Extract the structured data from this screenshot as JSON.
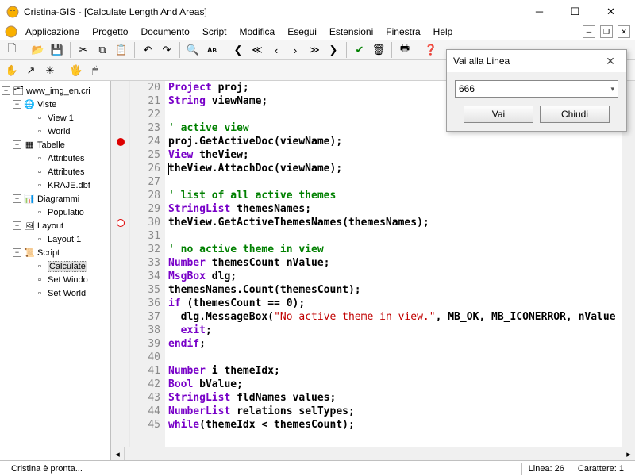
{
  "window": {
    "title": "Cristina-GIS - [Calculate Length And Areas]"
  },
  "menus": [
    "Applicazione",
    "Progetto",
    "Documento",
    "Script",
    "Modifica",
    "Esegui",
    "Estensioni",
    "Finestra",
    "Help"
  ],
  "tree": {
    "root": "www_img_en.cri",
    "groups": [
      {
        "label": "Viste",
        "icon": "globe",
        "items": [
          "View 1",
          "World"
        ]
      },
      {
        "label": "Tabelle",
        "icon": "table",
        "items": [
          "Attributes",
          "Attributes",
          "KRAJE.dbf"
        ]
      },
      {
        "label": "Diagrammi",
        "icon": "chart",
        "items": [
          "Populatio"
        ]
      },
      {
        "label": "Layout",
        "icon": "layout",
        "items": [
          "Layout 1"
        ]
      },
      {
        "label": "Script",
        "icon": "script",
        "items": [
          "Calculate",
          "Set Windo",
          "Set World"
        ],
        "selected": 0
      }
    ]
  },
  "editor": {
    "first_line": 20,
    "cursor_line": 26,
    "breakpoints": {
      "24": "solid",
      "30": "hollow"
    },
    "lines": [
      {
        "n": 20,
        "t": [
          [
            "kw",
            "Project"
          ],
          [
            "txt",
            " proj;"
          ]
        ]
      },
      {
        "n": 21,
        "t": [
          [
            "kw",
            "String"
          ],
          [
            "txt",
            " viewName;"
          ]
        ]
      },
      {
        "n": 22,
        "t": []
      },
      {
        "n": 23,
        "t": [
          [
            "cm",
            "' active view"
          ]
        ]
      },
      {
        "n": 24,
        "t": [
          [
            "txt",
            "proj.GetActiveDoc(viewName);"
          ]
        ]
      },
      {
        "n": 25,
        "t": [
          [
            "kw",
            "View"
          ],
          [
            "txt",
            " theView;"
          ]
        ]
      },
      {
        "n": 26,
        "t": [
          [
            "txt",
            "theView.AttachDoc(viewName);"
          ]
        ]
      },
      {
        "n": 27,
        "t": []
      },
      {
        "n": 28,
        "t": [
          [
            "cm",
            "' list of all active themes"
          ]
        ]
      },
      {
        "n": 29,
        "t": [
          [
            "kw",
            "StringList"
          ],
          [
            "txt",
            " themesNames;"
          ]
        ]
      },
      {
        "n": 30,
        "t": [
          [
            "txt",
            "theView.GetActiveThemesNames(themesNames);"
          ]
        ]
      },
      {
        "n": 31,
        "t": []
      },
      {
        "n": 32,
        "t": [
          [
            "cm",
            "' no active theme in view"
          ]
        ]
      },
      {
        "n": 33,
        "t": [
          [
            "kw",
            "Number"
          ],
          [
            "txt",
            " themesCount nValue;"
          ]
        ]
      },
      {
        "n": 34,
        "t": [
          [
            "kw",
            "MsgBox"
          ],
          [
            "txt",
            " dlg;"
          ]
        ]
      },
      {
        "n": 35,
        "t": [
          [
            "txt",
            "themesNames.Count(themesCount);"
          ]
        ]
      },
      {
        "n": 36,
        "t": [
          [
            "kw",
            "if"
          ],
          [
            "txt",
            " (themesCount == 0);"
          ]
        ]
      },
      {
        "n": 37,
        "t": [
          [
            "txt",
            "  dlg.MessageBox("
          ],
          [
            "str",
            "\"No active theme in view.\""
          ],
          [
            "txt",
            ", MB_OK, MB_ICONERROR, nValue"
          ]
        ]
      },
      {
        "n": 38,
        "t": [
          [
            "txt",
            "  "
          ],
          [
            "kw",
            "exit"
          ],
          [
            "txt",
            ";"
          ]
        ]
      },
      {
        "n": 39,
        "t": [
          [
            "kw",
            "endif"
          ],
          [
            "txt",
            ";"
          ]
        ]
      },
      {
        "n": 40,
        "t": []
      },
      {
        "n": 41,
        "t": [
          [
            "kw",
            "Number"
          ],
          [
            "txt",
            " i themeIdx;"
          ]
        ]
      },
      {
        "n": 42,
        "t": [
          [
            "kw",
            "Bool"
          ],
          [
            "txt",
            " bValue;"
          ]
        ]
      },
      {
        "n": 43,
        "t": [
          [
            "kw",
            "StringList"
          ],
          [
            "txt",
            " fldNames values;"
          ]
        ]
      },
      {
        "n": 44,
        "t": [
          [
            "kw",
            "NumberList"
          ],
          [
            "txt",
            " relations selTypes;"
          ]
        ]
      },
      {
        "n": 45,
        "t": [
          [
            "kw",
            "while"
          ],
          [
            "txt",
            "(themeIdx < themesCount);"
          ]
        ]
      }
    ]
  },
  "dialog": {
    "title": "Vai alla Linea",
    "value": "666",
    "go": "Vai",
    "close": "Chiudi"
  },
  "status": {
    "text": "Cristina è pronta...",
    "line_label": "Linea: 26",
    "char_label": "Carattere: 1"
  }
}
